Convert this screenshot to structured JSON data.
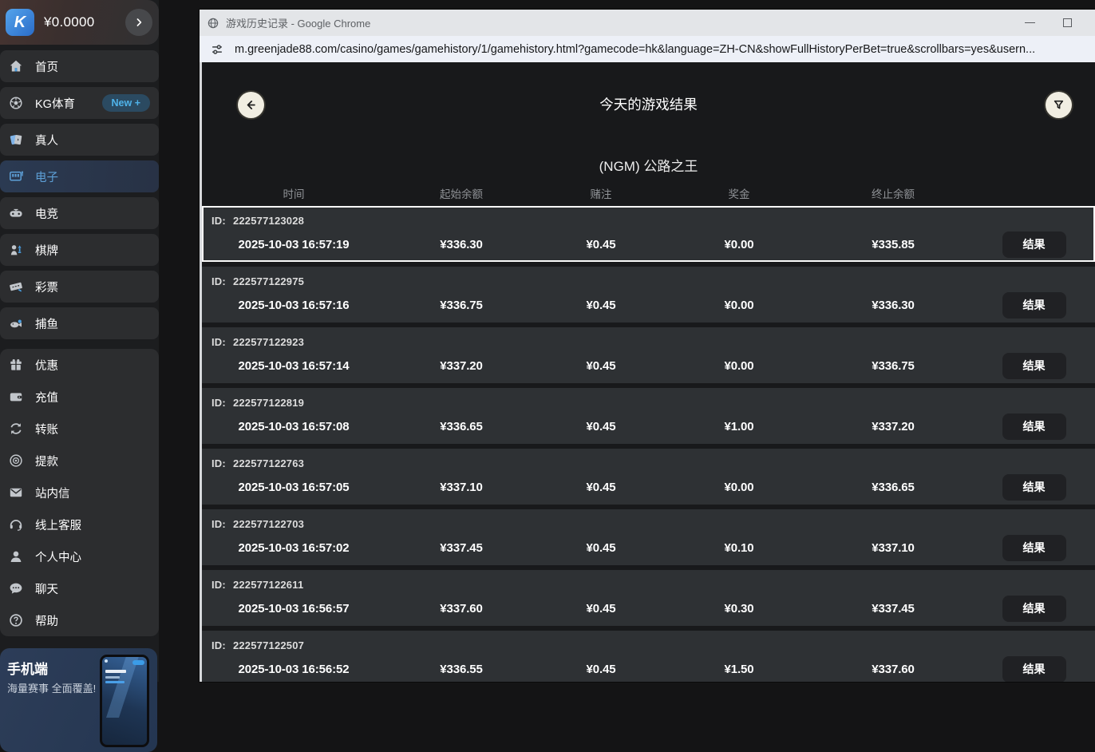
{
  "colors": {
    "accent_blue": "#4a9fe3",
    "active_item_text": "#5d9fd6",
    "cream_button": "#f1eee2",
    "row_bg": "#2e3134",
    "badge_bg": "#2b4a61",
    "badge_text": "#4fb3ea"
  },
  "sidebar": {
    "logo_letter": "K",
    "balance": "¥0.0000",
    "menu_top": [
      {
        "key": "home",
        "icon": "home-icon",
        "label": "首页"
      },
      {
        "key": "sports",
        "icon": "soccer-icon",
        "label": "KG体育",
        "badge": "New +"
      },
      {
        "key": "live",
        "icon": "cards-icon",
        "label": "真人"
      },
      {
        "key": "slots",
        "icon": "slot-machine-icon",
        "label": "电子",
        "active": true
      },
      {
        "key": "esports",
        "icon": "gamepad-icon",
        "label": "电竞"
      },
      {
        "key": "chess",
        "icon": "chess-pawn-icon",
        "label": "棋牌"
      },
      {
        "key": "lottery",
        "icon": "ticket-icon",
        "label": "彩票"
      },
      {
        "key": "fishing",
        "icon": "fish-icon",
        "label": "捕鱼"
      }
    ],
    "menu_bottom": [
      {
        "key": "promotions",
        "icon": "gift-icon",
        "label": "优惠"
      },
      {
        "key": "deposit",
        "icon": "wallet-icon",
        "label": "充值"
      },
      {
        "key": "transfer",
        "icon": "transfer-arrows-icon",
        "label": "转账"
      },
      {
        "key": "withdraw",
        "icon": "coin-icon",
        "label": "提款"
      },
      {
        "key": "inbox",
        "icon": "mail-icon",
        "label": "站内信"
      },
      {
        "key": "support",
        "icon": "headset-icon",
        "label": "线上客服"
      },
      {
        "key": "profile",
        "icon": "person-icon",
        "label": "个人中心"
      },
      {
        "key": "chat",
        "icon": "chat-bubble-icon",
        "label": "聊天"
      },
      {
        "key": "help",
        "icon": "question-icon",
        "label": "帮助"
      }
    ],
    "promo": {
      "title": "手机端",
      "subtitle": "海量赛事 全面覆盖!"
    }
  },
  "window": {
    "title": "游戏历史记录 - Google Chrome",
    "url": "m.greenjade88.com/casino/games/gamehistory/1/gamehistory.html?gamecode=hk&language=ZH-CN&showFullHistoryPerBet=true&scrollbars=yes&usern..."
  },
  "page": {
    "title": "今天的游戏结果",
    "game_name": "(NGM) 公路之王",
    "columns": [
      "时间",
      "起始余额",
      "赌注",
      "奖金",
      "终止余额"
    ],
    "id_prefix": "ID:",
    "result_label": "结果",
    "rows": [
      {
        "id": "222577123028",
        "time": "2025-10-03 16:57:19",
        "start": "¥336.30",
        "bet": "¥0.45",
        "prize": "¥0.00",
        "end": "¥335.85",
        "highlighted": true
      },
      {
        "id": "222577122975",
        "time": "2025-10-03 16:57:16",
        "start": "¥336.75",
        "bet": "¥0.45",
        "prize": "¥0.00",
        "end": "¥336.30"
      },
      {
        "id": "222577122923",
        "time": "2025-10-03 16:57:14",
        "start": "¥337.20",
        "bet": "¥0.45",
        "prize": "¥0.00",
        "end": "¥336.75"
      },
      {
        "id": "222577122819",
        "time": "2025-10-03 16:57:08",
        "start": "¥336.65",
        "bet": "¥0.45",
        "prize": "¥1.00",
        "end": "¥337.20"
      },
      {
        "id": "222577122763",
        "time": "2025-10-03 16:57:05",
        "start": "¥337.10",
        "bet": "¥0.45",
        "prize": "¥0.00",
        "end": "¥336.65"
      },
      {
        "id": "222577122703",
        "time": "2025-10-03 16:57:02",
        "start": "¥337.45",
        "bet": "¥0.45",
        "prize": "¥0.10",
        "end": "¥337.10"
      },
      {
        "id": "222577122611",
        "time": "2025-10-03 16:56:57",
        "start": "¥337.60",
        "bet": "¥0.45",
        "prize": "¥0.30",
        "end": "¥337.45"
      },
      {
        "id": "222577122507",
        "time": "2025-10-03 16:56:52",
        "start": "¥336.55",
        "bet": "¥0.45",
        "prize": "¥1.50",
        "end": "¥337.60"
      }
    ]
  }
}
